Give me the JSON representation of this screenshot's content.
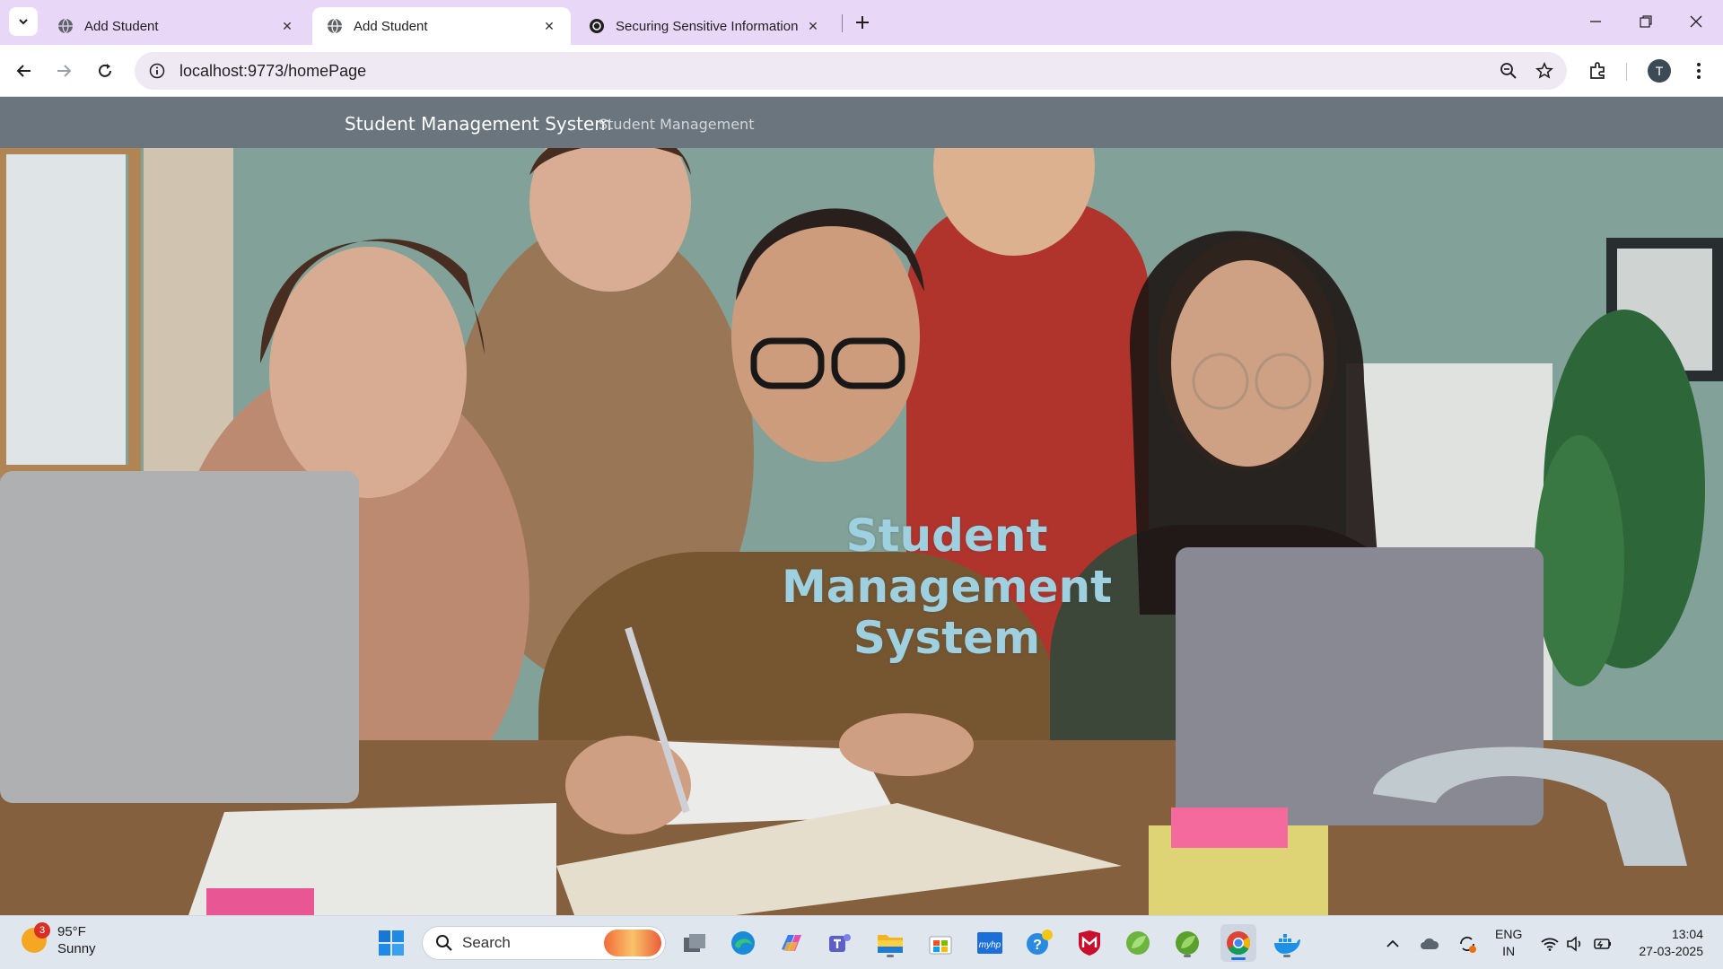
{
  "browser": {
    "tabs": [
      {
        "title": "Add Student",
        "active": false,
        "icon": "globe-icon"
      },
      {
        "title": "Add Student",
        "active": true,
        "icon": "globe-icon"
      },
      {
        "title": "Securing Sensitive Information",
        "active": false,
        "icon": "openai-icon"
      }
    ],
    "url": "localhost:9773/homePage",
    "profile_initial": "T"
  },
  "page": {
    "navbar": {
      "brand": "Student Management System",
      "links": [
        "Student Management"
      ],
      "background": "#6b757e"
    },
    "hero": {
      "title": "Student Management System",
      "title_color": "#9fd0e0"
    }
  },
  "taskbar": {
    "weather": {
      "badge": "3",
      "temp": "95°F",
      "condition": "Sunny"
    },
    "search_label": "Search",
    "pinned_apps": [
      "windows-start-icon",
      "search",
      "task-view-icon",
      "edge-icon",
      "copilot-icon",
      "teams-icon",
      "file-explorer-icon",
      "ms-store-icon",
      "myhp-icon",
      "help-icon",
      "mcafee-icon",
      "spring-tool-icon",
      "spring-tool-icon-2",
      "chrome-icon",
      "docker-icon"
    ],
    "language": {
      "line1": "ENG",
      "line2": "IN"
    },
    "time": "13:04",
    "date": "27-03-2025"
  }
}
